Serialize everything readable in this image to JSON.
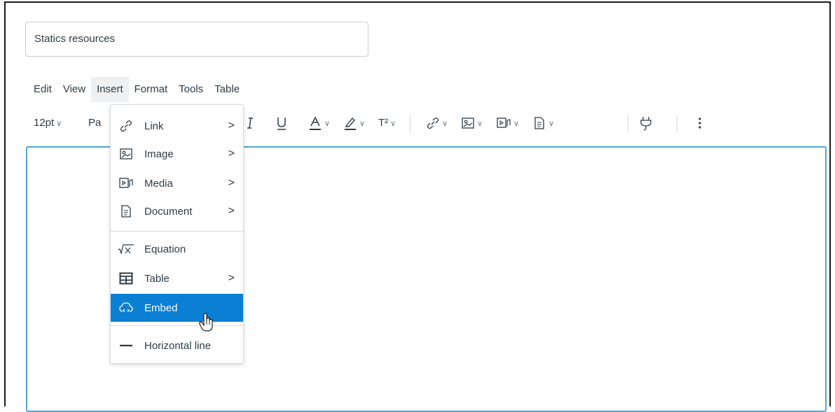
{
  "title_field": {
    "value": "Statics resources"
  },
  "menubar": [
    "Edit",
    "View",
    "Insert",
    "Format",
    "Tools",
    "Table"
  ],
  "toolbar": {
    "font_size": "12pt",
    "paragraph_partial": "Pa",
    "chevron": "∨",
    "superscript_label": "T²"
  },
  "insert_menu": {
    "items": [
      {
        "label": "Link",
        "icon": "link-icon",
        "submenu": true
      },
      {
        "label": "Image",
        "icon": "image-icon",
        "submenu": true
      },
      {
        "label": "Media",
        "icon": "media-icon",
        "submenu": true
      },
      {
        "label": "Document",
        "icon": "document-icon",
        "submenu": true
      },
      {
        "label": "Equation",
        "icon": "equation-icon",
        "submenu": false
      },
      {
        "label": "Table",
        "icon": "table-icon",
        "submenu": true
      },
      {
        "label": "Embed",
        "icon": "embed-icon",
        "submenu": false,
        "highlighted": true
      },
      {
        "label": "Horizontal line",
        "icon": "horizontal-line-icon",
        "submenu": false
      }
    ],
    "submenu_arrow": ">",
    "highlight_color": "#0b7fd4"
  },
  "colors": {
    "editor_border": "#4fa3dc",
    "text": "#2d3b45"
  }
}
